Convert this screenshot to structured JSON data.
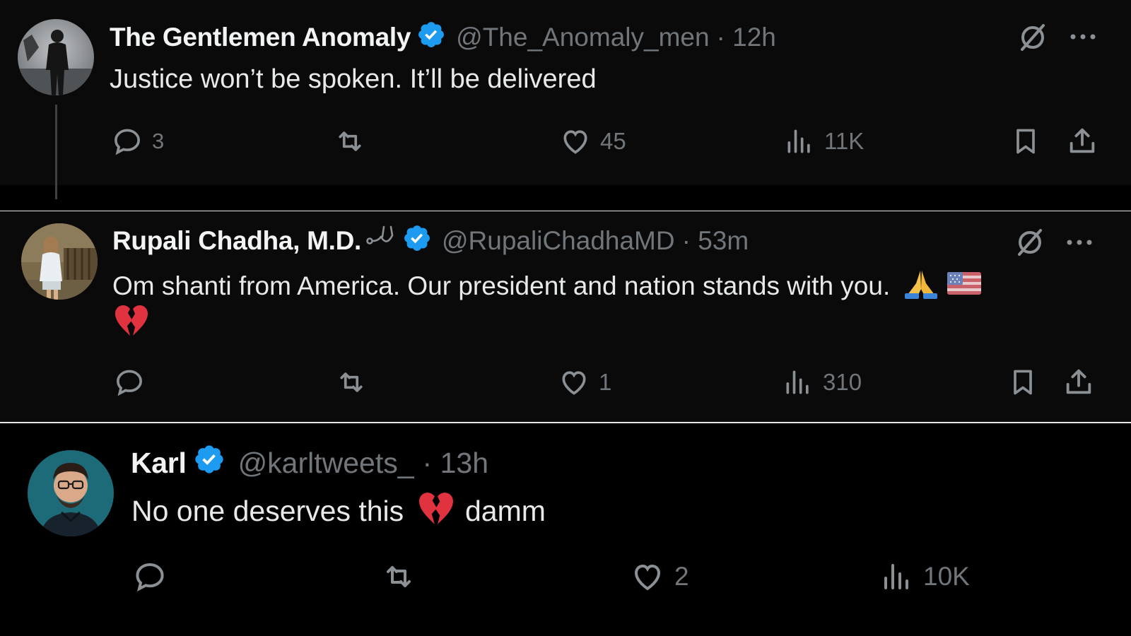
{
  "posts": [
    {
      "display_name": "The Gentlemen Anomaly",
      "handle": "@The_Anomaly_men",
      "time": "· 12h",
      "text": "Justice won’t be spoken. It’ll be delivered",
      "replies": "3",
      "likes": "45",
      "views": "11K",
      "verified": true
    },
    {
      "display_name": "Rupali Chadha, M.D.",
      "handle": "@RupaliChadhaMD",
      "time": "· 53m",
      "text": "Om shanti from America. Our president and nation stands with you.",
      "replies": "",
      "likes": "1",
      "views": "310",
      "verified": true
    },
    {
      "display_name": "Karl",
      "handle": "@karltweets_",
      "time": "· 13h",
      "text_before": "No one deserves this",
      "text_after": "damm",
      "replies": "",
      "likes": "2",
      "views": "10K",
      "verified": true
    }
  ],
  "icons": [
    "grok-icon",
    "more-icon",
    "reply-icon",
    "repost-icon",
    "like-icon",
    "views-icon",
    "bookmark-icon",
    "share-icon",
    "verified-badge-icon",
    "folded-hands-emoji",
    "us-flag-emoji",
    "broken-heart-emoji",
    "stethoscope-emoji"
  ],
  "colors": {
    "background": "#000000",
    "panel": "#0a0a0a",
    "text": "#e7e9ea",
    "secondary_text": "#71767b",
    "verified_blue": "#1d9bf0",
    "separator": "#e4e6e8"
  }
}
